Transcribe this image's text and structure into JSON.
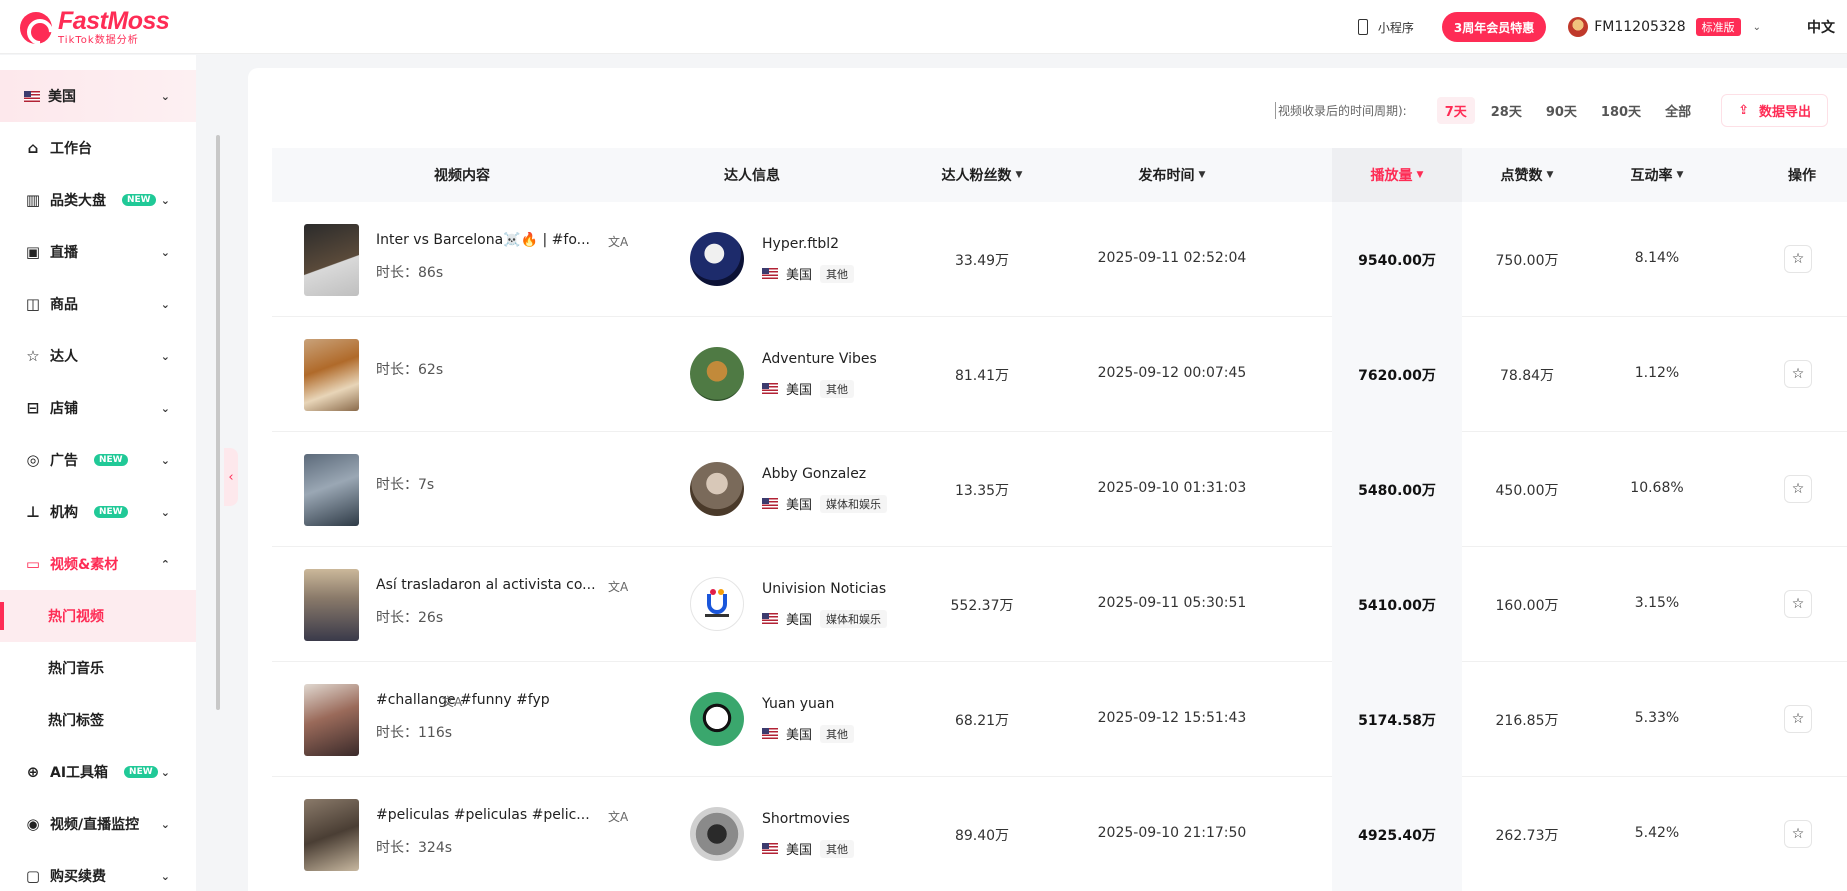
{
  "header": {
    "logo_name": "FastMoss",
    "logo_sub": "TikTok数据分析",
    "mini_program": "小程序",
    "promo": "3周年会员特惠",
    "user_name": "FM11205328",
    "user_badge": "标准版",
    "language": "中文"
  },
  "sidebar": {
    "region": "美国",
    "items": [
      {
        "label": "工作台",
        "icon": "home-icon",
        "new": ""
      },
      {
        "label": "品类大盘",
        "icon": "chart-icon",
        "new": "NEW"
      },
      {
        "label": "直播",
        "icon": "live-icon",
        "new": ""
      },
      {
        "label": "商品",
        "icon": "product-icon",
        "new": ""
      },
      {
        "label": "达人",
        "icon": "influencer-icon",
        "new": ""
      },
      {
        "label": "店铺",
        "icon": "store-icon",
        "new": ""
      },
      {
        "label": "广告",
        "icon": "ad-icon",
        "new": "NEW"
      },
      {
        "label": "机构",
        "icon": "org-icon",
        "new": "NEW"
      },
      {
        "label": "视频&素材",
        "icon": "video-icon",
        "new": ""
      }
    ],
    "sub_items": [
      "热门视频",
      "热门音乐",
      "热门标签"
    ],
    "more_items": [
      {
        "label": "AI工具箱",
        "icon": "ai-icon",
        "new": "NEW"
      },
      {
        "label": "视频/直播监控",
        "icon": "monitor-icon",
        "new": ""
      },
      {
        "label": "购买续费",
        "icon": "purchase-icon",
        "new": ""
      }
    ]
  },
  "filter": {
    "label": "视频收录后的时间周期):",
    "periods": [
      "7天",
      "28天",
      "90天",
      "180天",
      "全部"
    ],
    "active_period": "7天",
    "export": "数据导出"
  },
  "table": {
    "headers": {
      "content": "视频内容",
      "creator": "达人信息",
      "followers": "达人粉丝数",
      "publish": "发布时间",
      "plays": "播放量",
      "likes": "点赞数",
      "engagement": "互动率",
      "action": "操作"
    },
    "duration_label": "时长：",
    "rows": [
      {
        "title": "Inter vs Barcelona☠️🔥 | #fo...",
        "duration": "86s",
        "creator": "Hyper.ftbl2",
        "country": "美国",
        "category": "其他",
        "followers": "33.49万",
        "date": "2025-09-11 02:52:04",
        "plays": "9540.00万",
        "likes": "750.00万",
        "engagement": "8.14%",
        "has_translate": true
      },
      {
        "title": "",
        "duration": "62s",
        "creator": "Adventure Vibes",
        "country": "美国",
        "category": "其他",
        "followers": "81.41万",
        "date": "2025-09-12 00:07:45",
        "plays": "7620.00万",
        "likes": "78.84万",
        "engagement": "1.12%",
        "has_translate": false
      },
      {
        "title": "",
        "duration": "7s",
        "creator": "Abby Gonzalez",
        "country": "美国",
        "category": "媒体和娱乐",
        "followers": "13.35万",
        "date": "2025-09-10 01:31:03",
        "plays": "5480.00万",
        "likes": "450.00万",
        "engagement": "10.68%",
        "has_translate": false
      },
      {
        "title": "Así trasladaron al activista co...",
        "duration": "26s",
        "creator": "Univision Noticias",
        "country": "美国",
        "category": "媒体和娱乐",
        "followers": "552.37万",
        "date": "2025-09-11 05:30:51",
        "plays": "5410.00万",
        "likes": "160.00万",
        "engagement": "3.15%",
        "has_translate": true
      },
      {
        "title": "#challange #funny #fyp",
        "duration": "116s",
        "creator": "Yuan yuan",
        "country": "美国",
        "category": "其他",
        "followers": "68.21万",
        "date": "2025-09-12 15:51:43",
        "plays": "5174.58万",
        "likes": "216.85万",
        "engagement": "5.33%",
        "has_translate": true
      },
      {
        "title": "#peliculas #peliculas #pelic...",
        "duration": "324s",
        "creator": "Shortmovies",
        "country": "美国",
        "category": "其他",
        "followers": "89.40万",
        "date": "2025-09-10 21:17:50",
        "plays": "4925.40万",
        "likes": "262.73万",
        "engagement": "5.42%",
        "has_translate": true
      }
    ]
  },
  "colors": {
    "brand": "#fe2c55",
    "new_badge": "#20c997"
  }
}
